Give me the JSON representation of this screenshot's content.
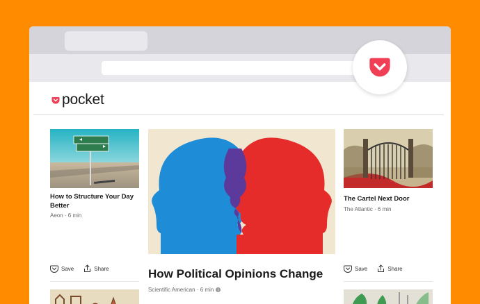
{
  "logo": {
    "text": "pocket"
  },
  "left_card": {
    "title": "How to Structure Your Day Better",
    "source": "Aeon · 6 min",
    "save": "Save",
    "share": "Share"
  },
  "featured": {
    "title": "How Political Opinions Change",
    "source": "Scientific American · 6 min"
  },
  "right_card": {
    "title": "The Cartel Next Door",
    "source": "The Atlantic · 6 min",
    "save": "Save",
    "share": "Share"
  },
  "colors": {
    "background": "#FF8C00",
    "brand": "#EF4056",
    "blue": "#1E8CD6",
    "red": "#E62B2B",
    "purple": "#5B3A9B"
  }
}
